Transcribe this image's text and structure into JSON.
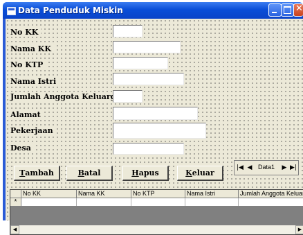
{
  "window": {
    "title": "Data Penduduk Miskin"
  },
  "fields": [
    {
      "label": "No KK",
      "value": ""
    },
    {
      "label": "Nama KK",
      "value": ""
    },
    {
      "label": "No KTP",
      "value": ""
    },
    {
      "label": "Nama Istri",
      "value": ""
    },
    {
      "label": "Jumlah Anggota Keluarga",
      "value": ""
    },
    {
      "label": "Alamat",
      "value": ""
    },
    {
      "label": "Pekerjaan",
      "value": ""
    },
    {
      "label": "Desa",
      "value": ""
    }
  ],
  "buttons": [
    {
      "accel": "T",
      "rest": "ambah"
    },
    {
      "accel": "B",
      "rest": "atal"
    },
    {
      "accel": "H",
      "rest": "apus"
    },
    {
      "accel": "K",
      "rest": "eluar"
    }
  ],
  "data_control": {
    "caption": "Data1"
  },
  "grid": {
    "columns": [
      "No KK",
      "Nama KK",
      "No KTP",
      "Nama Istri",
      "Jumlah Anggota Keluarga"
    ],
    "new_row_marker": "*"
  }
}
